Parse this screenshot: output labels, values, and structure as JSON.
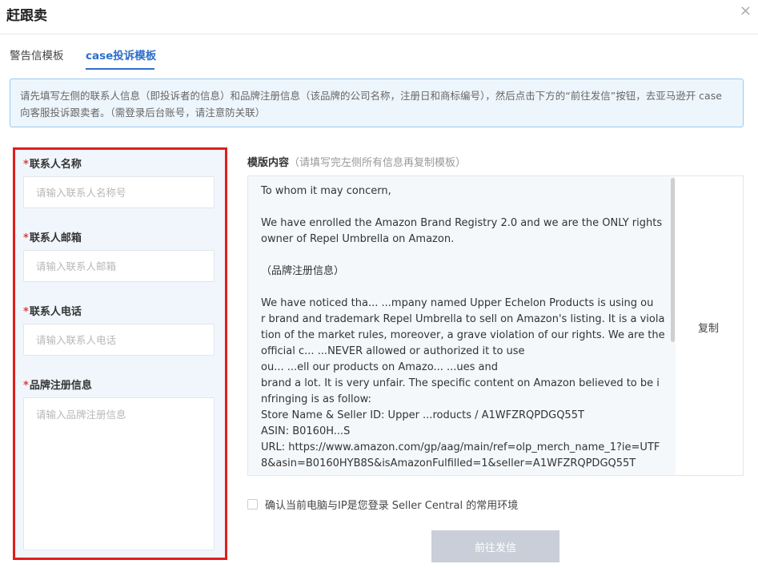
{
  "dialog": {
    "title": "赶跟卖",
    "close_icon": "×"
  },
  "tabs": [
    {
      "label": "警告信模板",
      "active": false
    },
    {
      "label": "case投诉模板",
      "active": true
    }
  ],
  "notice": {
    "text": "请先填写左侧的联系人信息（即投诉者的信息）和品牌注册信息（该品牌的公司名称，注册日和商标编号），然后点击下方的“前往发信”按钮，去亚马逊开 case 向客服投诉跟卖者。（需登录后台账号，请注意防关联）"
  },
  "form": {
    "required_mark": "*",
    "fields": [
      {
        "label": "联系人名称",
        "placeholder": "请输入联系人名称号",
        "value": ""
      },
      {
        "label": "联系人邮箱",
        "placeholder": "请输入联系人邮箱",
        "value": ""
      },
      {
        "label": "联系人电话",
        "placeholder": "请输入联系人电话",
        "value": ""
      },
      {
        "label": "品牌注册信息",
        "placeholder": "请输入品牌注册信息",
        "value": ""
      }
    ]
  },
  "template": {
    "label": "模版内容",
    "hint": "（请填写完左侧所有信息再复制模板）",
    "copy_label": "复制",
    "paragraphs": [
      "To whom it may concern,",
      "We have enrolled the Amazon Brand Registry 2.0 and we are the ONLY rights owner of Repel Umbrella on Amazon.",
      "（品牌注册信息）"
    ],
    "lines": [
      "We have noticed tha... ...mpany named Upper Echelon Products  is using ou",
      "r brand and trademark Repel Umbrella to sell on Amazon's listing. It is a viola",
      "tion of the market rules, moreover, a grave violation of our rights. We are the",
      "official c... ...NEVER allowed or authorized it to use",
      " ou... ...ell our products on Amazo... ...ues and",
      "brand a lot. It is very unfair. The specific content on Amazon believed to be i",
      "nfringing is as follow:",
      "Store Name & Seller ID: Upper ...roducts / A1WFZRQPDGQ55T",
      "ASIN: B0160H...S",
      "URL: https://www.amazon.com/gp/aag/main/ref=olp_merch_name_1?ie=UTF",
      "8&asin=B0160HYB8S&isAmazonFulfilled=1&seller=A1WFZRQPDGQ55T"
    ]
  },
  "confirm": {
    "label": "确认当前电脑与IP是您登录 Seller Central 的常用环境",
    "checked": false
  },
  "submit": {
    "label": "前往发信",
    "enabled": false
  },
  "colors": {
    "accent": "#2e6fcb",
    "highlight_border": "#e01d1d",
    "required": "#e0403b",
    "disabled_button": "#c9ced8"
  }
}
